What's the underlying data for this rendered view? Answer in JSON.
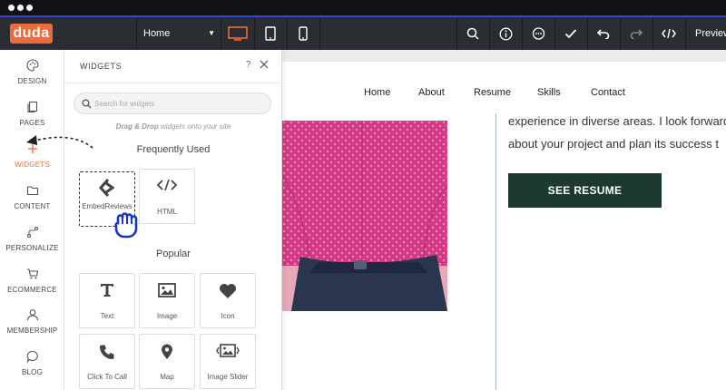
{
  "titlebar": {
    "dots": 3
  },
  "toolbar": {
    "logo": "duda",
    "page_select": "Home",
    "preview_label": "Preview"
  },
  "leftnav": {
    "items": [
      {
        "label": "DESIGN",
        "icon": "palette-icon"
      },
      {
        "label": "PAGES",
        "icon": "pages-icon"
      },
      {
        "label": "WIDGETS",
        "icon": "plus-icon",
        "active": true
      },
      {
        "label": "CONTENT",
        "icon": "folder-icon"
      },
      {
        "label": "PERSONALIZE",
        "icon": "personalize-icon"
      },
      {
        "label": "ECOMMERCE",
        "icon": "cart-icon"
      },
      {
        "label": "MEMBERSHIP",
        "icon": "user-icon"
      },
      {
        "label": "BLOG",
        "icon": "chat-bubble-icon"
      }
    ]
  },
  "panel": {
    "title": "WIDGETS",
    "help": "?",
    "search_placeholder": "Search for widgets",
    "dnd_hint_bold": "Drag & Drop",
    "dnd_hint_rest": " widgets onto your site",
    "frequently_used_title": "Frequently Used",
    "frequently_used": [
      {
        "label": "EmbedReviews",
        "icon": "embed-reviews-icon"
      },
      {
        "label": "HTML",
        "icon": "code-icon"
      }
    ],
    "popular_title": "Popular",
    "popular": [
      {
        "label": "Text",
        "icon": "text-icon"
      },
      {
        "label": "Image",
        "icon": "image-icon"
      },
      {
        "label": "Icon",
        "icon": "heart-icon"
      },
      {
        "label": "Click To Call",
        "icon": "phone-icon"
      },
      {
        "label": "Map",
        "icon": "map-pin-icon"
      },
      {
        "label": "Image Slider",
        "icon": "image-slider-icon"
      }
    ]
  },
  "site": {
    "nav": [
      "Home",
      "About",
      "Resume",
      "Skills",
      "Contact"
    ],
    "text_line1": "experience in diverse areas. I look forward",
    "text_line2": "about your project and plan its success t",
    "cta": "SEE RESUME"
  },
  "colors": {
    "accent": "#f06b3a",
    "toolbar": "#2a2d32",
    "cta": "#1d3a30",
    "photo_bg": "#e7a8b8",
    "shirt": "#d43a86"
  }
}
